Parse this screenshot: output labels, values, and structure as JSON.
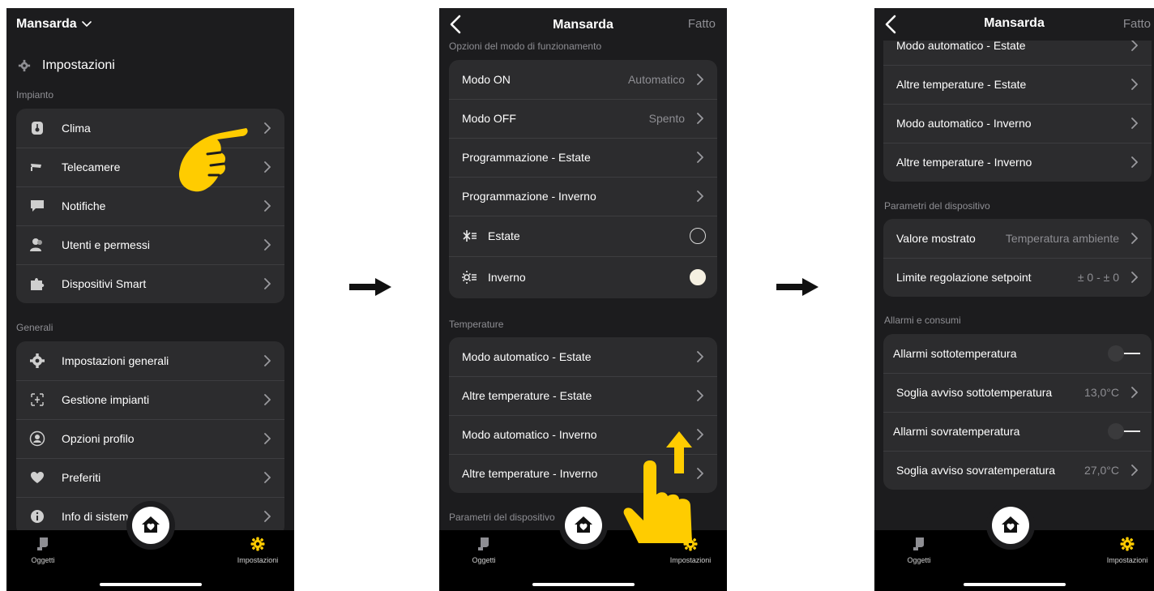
{
  "colors": {
    "accent": "#ffcc00",
    "background": "#1c1c1e",
    "card": "#2c2c2e",
    "secondary_text": "#8e8e93"
  },
  "tabbar": {
    "left_label": "Oggetti",
    "right_label": "Impostazioni"
  },
  "screen1": {
    "house_name": "Mansarda",
    "settings_title": "Impostazioni",
    "section_impianto": "Impianto",
    "impianto_items": [
      {
        "label": "Clima",
        "icon": "thermostat-icon"
      },
      {
        "label": "Telecamere",
        "icon": "camera-icon"
      },
      {
        "label": "Notifiche",
        "icon": "chat-bubble-icon"
      },
      {
        "label": "Utenti e permessi",
        "icon": "users-icon"
      },
      {
        "label": "Dispositivi Smart",
        "icon": "puzzle-icon"
      }
    ],
    "section_generali": "Generali",
    "generali_items": [
      {
        "label": "Impostazioni generali",
        "icon": "gear-icon"
      },
      {
        "label": "Gestione impianti",
        "icon": "network-icon"
      },
      {
        "label": "Opzioni profilo",
        "icon": "profile-icon"
      },
      {
        "label": "Preferiti",
        "icon": "heart-icon"
      },
      {
        "label": "Info di sistema",
        "icon": "info-icon"
      }
    ]
  },
  "screen2": {
    "title": "Mansarda",
    "done": "Fatto",
    "section_modes": "Opzioni del modo di funzionamento",
    "modes": [
      {
        "label": "Modo ON",
        "value": "Automatico"
      },
      {
        "label": "Modo OFF",
        "value": "Spento"
      },
      {
        "label": "Programmazione - Estate",
        "value": ""
      },
      {
        "label": "Programmazione - Inverno",
        "value": ""
      }
    ],
    "season_summer": "Estate",
    "season_winter": "Inverno",
    "selected_season": "Inverno",
    "section_temperature": "Temperature",
    "temperatures": [
      "Modo automatico - Estate",
      "Altre temperature - Estate",
      "Modo automatico - Inverno",
      "Altre temperature - Inverno"
    ],
    "section_device": "Parametri del dispositivo"
  },
  "screen3": {
    "title": "Mansarda",
    "done": "Fatto",
    "temperatures": [
      "Modo automatico - Estate",
      "Altre temperature - Estate",
      "Modo automatico - Inverno",
      "Altre temperature - Inverno"
    ],
    "section_device": "Parametri del dispositivo",
    "device_params": [
      {
        "label": "Valore mostrato",
        "value": "Temperatura ambiente"
      },
      {
        "label": "Limite regolazione setpoint",
        "value": "± 0 - ± 0"
      }
    ],
    "section_alarms": "Allarmi e consumi",
    "alarm_low_label": "Allarmi sottotemperatura",
    "alarm_low_enabled": false,
    "threshold_low_label": "Soglia avviso sottotemperatura",
    "threshold_low_value": "13,0°C",
    "alarm_high_label": "Allarmi sovratemperatura",
    "alarm_high_enabled": false,
    "threshold_high_label": "Soglia avviso sovratemperatura",
    "threshold_high_value": "27,0°C"
  }
}
